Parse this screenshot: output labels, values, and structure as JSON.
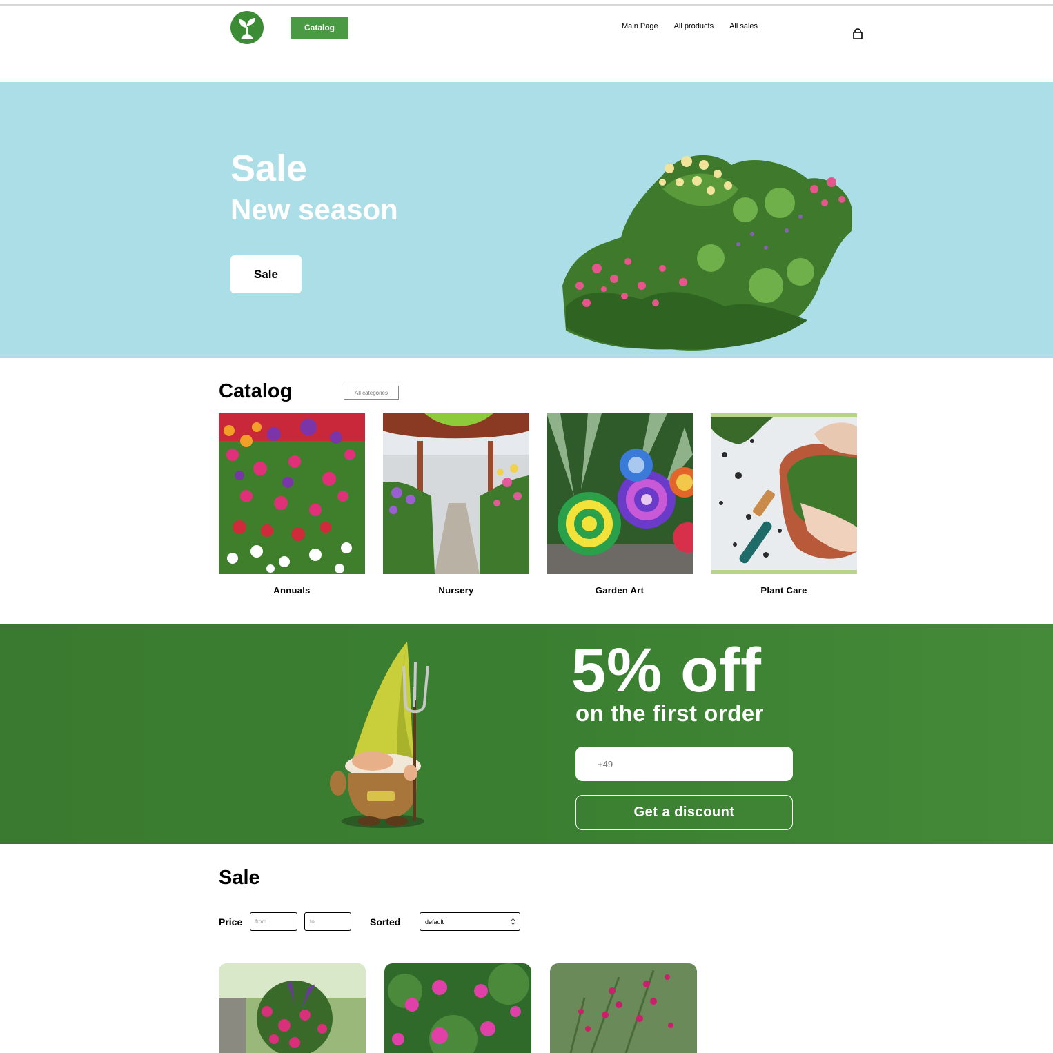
{
  "header": {
    "catalog_button": "Catalog",
    "nav": [
      "Main Page",
      "All products",
      "All sales"
    ],
    "logo_icon": "leaf-sprout-icon",
    "cart_icon": "shopping-bag-icon",
    "brand_color": "#4a9a43"
  },
  "hero": {
    "title": "Sale",
    "subtitle": "New season",
    "button_label": "Sale",
    "background_color": "#abdee6"
  },
  "catalog": {
    "title": "Catalog",
    "all_categories_button": "All categories",
    "categories": [
      {
        "label": "Annuals"
      },
      {
        "label": "Nursery"
      },
      {
        "label": "Garden Art"
      },
      {
        "label": "Plant Care"
      }
    ]
  },
  "promo": {
    "headline": "5% off",
    "subheadline": "on the first order",
    "phone_placeholder": "+49",
    "button_label": "Get a discount",
    "background_color": "#3a7f31"
  },
  "sale": {
    "title": "Sale",
    "price_label": "Price",
    "price_from_placeholder": "from",
    "price_to_placeholder": "to",
    "sorted_label": "Sorted",
    "sorted_value": "default"
  }
}
